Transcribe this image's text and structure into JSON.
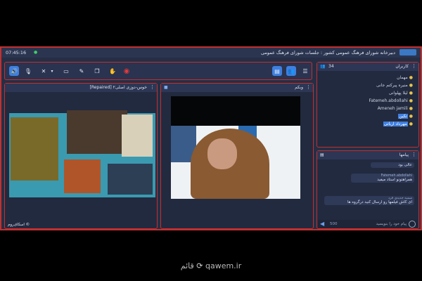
{
  "topbar": {
    "clock": "07:45:16",
    "title": "دبیرخانه شورای فرهنگ عمومی کشور : جلسات شورای فرهنگ عمومی"
  },
  "toolbar": {
    "buttons": [
      "speaker-icon",
      "microphone-icon",
      "camera-icon",
      "screen-share-icon",
      "whiteboard-icon",
      "files-icon",
      "raise-hand-icon",
      "record-icon"
    ],
    "right_buttons": [
      "chat-icon",
      "users-icon",
      "menu-icon"
    ]
  },
  "slide_panel": {
    "title": "خوس-دوزی اصلی۲ [Repaired]",
    "footer": "اسکای‌روم ©"
  },
  "webcam_panel": {
    "title": "وبکم"
  },
  "users_panel": {
    "title": "کاربران",
    "count": "34",
    "users": [
      {
        "name": "مهمان",
        "highlight": false
      },
      {
        "name": "منیره پیرکتم جانی",
        "highlight": false
      },
      {
        "name": "لیلا پهلوانی",
        "highlight": false
      },
      {
        "name": "Fatemeh.abdollahi",
        "highlight": false
      },
      {
        "name": "Ameneh jamili",
        "highlight": false
      },
      {
        "name": "تکین",
        "highlight": true
      },
      {
        "name": "مهرداد ارباتی",
        "highlight": true
      }
    ]
  },
  "messages_panel": {
    "title": "پیامها",
    "messages": [
      {
        "sender": "",
        "text": "عالی بود"
      },
      {
        "sender": "Fatemeh.abdollahi",
        "text": "همراهتونو استاد میفید"
      },
      {
        "sender": "سمیه جدیدی فرد",
        "text": "ای کاش فیلمها رو ارسال کنید درگروه ها"
      }
    ],
    "composer_placeholder": "پیام خود را بنویسید",
    "char_count": "500"
  },
  "credit": {
    "domain": "qawem.ir",
    "brand": "قائم"
  }
}
